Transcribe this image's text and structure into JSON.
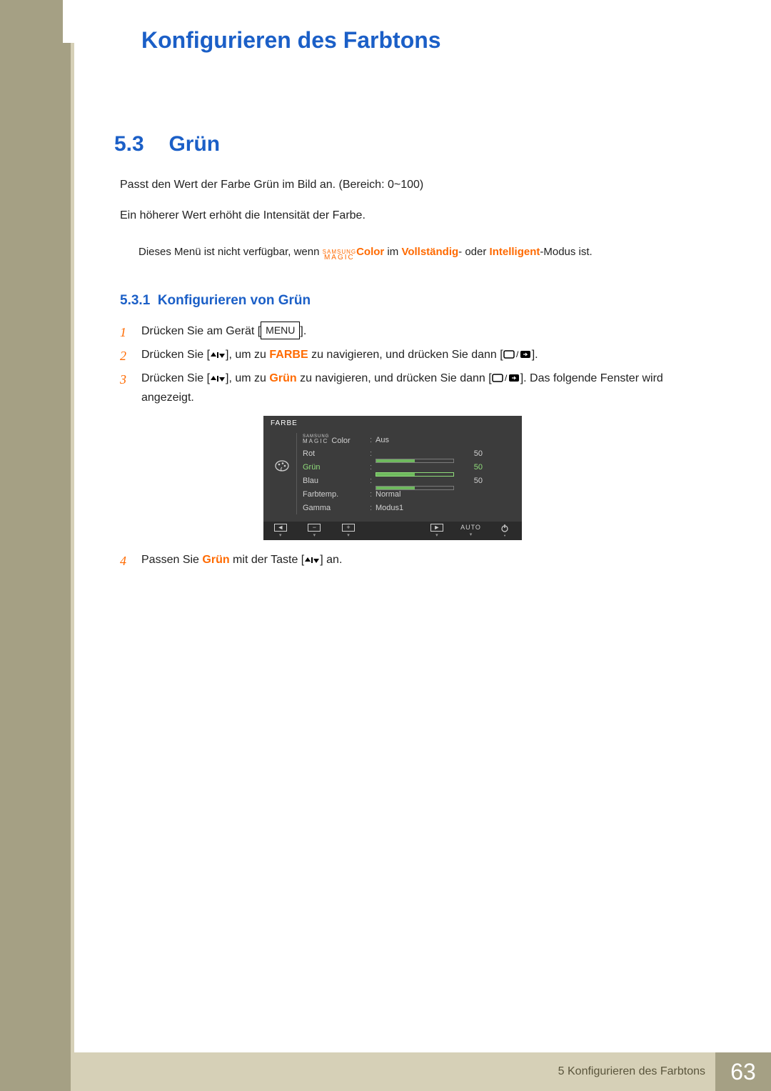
{
  "header": {
    "chapter_title": "Konfigurieren des Farbtons"
  },
  "section": {
    "number": "5.3",
    "title": "Grün"
  },
  "body": {
    "p1": "Passt den Wert der Farbe Grün im Bild an. (Bereich: 0~100)",
    "p2": "Ein höherer Wert erhöht die Intensität der Farbe."
  },
  "note": {
    "before": "Dieses Menü ist nicht verfügbar, wenn ",
    "magic_top": "SAMSUNG",
    "magic_bot": "MAGIC",
    "color_word": "Color",
    "mid1": " im ",
    "mode1": "Vollständig",
    "sep": "- oder ",
    "mode2": "Intelligent",
    "after": "-Modus ist."
  },
  "subsection": {
    "number": "5.3.1",
    "title": "Konfigurieren von Grün"
  },
  "steps": {
    "s1_a": "Drücken Sie am Gerät [",
    "s1_menu": "MENU",
    "s1_b": "].",
    "s2_a": "Drücken Sie [",
    "s2_b": "], um zu ",
    "s2_kw": "FARBE",
    "s2_c": " zu navigieren, und drücken Sie dann [",
    "s2_d": "].",
    "s3_a": "Drücken Sie [",
    "s3_b": "], um zu ",
    "s3_kw": "Grün",
    "s3_c": " zu navigieren, und drücken Sie dann [",
    "s3_d": "]. Das folgende Fenster wird angezeigt.",
    "s4_a": "Passen Sie ",
    "s4_kw": "Grün",
    "s4_b": " mit der Taste [",
    "s4_c": "] an."
  },
  "osd": {
    "title": "FARBE",
    "rows": [
      {
        "label_top": "SAMSUNG",
        "label_bot": "MAGIC",
        "label_suffix": " Color",
        "value": "Aus",
        "type": "text"
      },
      {
        "label": "Rot",
        "type": "slider",
        "num": "50",
        "pct": 50
      },
      {
        "label": "Grün",
        "type": "slider",
        "num": "50",
        "pct": 50,
        "active": true
      },
      {
        "label": "Blau",
        "type": "slider",
        "num": "50",
        "pct": 50
      },
      {
        "label": "Farbtemp.",
        "type": "text",
        "value": "Normal"
      },
      {
        "label": "Gamma",
        "type": "text",
        "value": "Modus1"
      }
    ],
    "buttons": {
      "auto": "AUTO"
    }
  },
  "footer": {
    "text": "5 Konfigurieren des Farbtons",
    "page": "63"
  }
}
